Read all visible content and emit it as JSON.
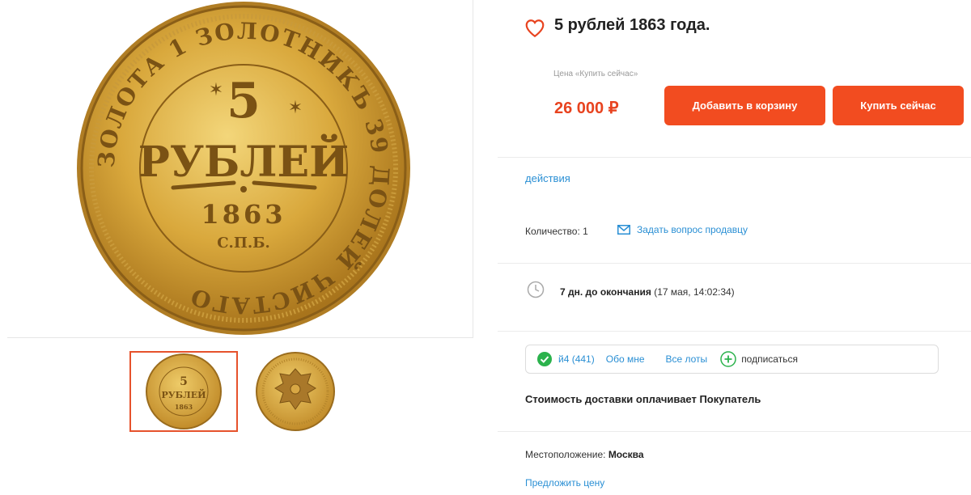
{
  "title": "5 рублей 1863 года.",
  "colors": {
    "accent": "#f24c20",
    "price": "#e8431f",
    "link": "#2a8fd4",
    "success": "#2bb24c"
  },
  "coin": {
    "denomination": "5",
    "word": "РУБЛЕЙ",
    "year": "1863",
    "mint": "С.П.Б.",
    "legend": "ЗОЛОТА 1 ЗОЛОТНИКЪ 39 ДОЛЕЙ ЧИСТАГО"
  },
  "price": {
    "label": "Цена «Купить сейчас»",
    "value": "26 000 ₽"
  },
  "buttons": {
    "add_to_cart": "Добавить в корзину",
    "buy_now": "Купить сейчас"
  },
  "actions_link": "действия",
  "quantity": {
    "text": "Количество: 1"
  },
  "ask_seller": "Задать вопрос продавцу",
  "ending": {
    "bold": "7 дн. до окончания",
    "date": "(17 мая, 14:02:34)"
  },
  "seller": {
    "name": "й4 (441)",
    "about": "Обо мне",
    "all_lots": "Все лоты",
    "subscribe": "подписаться"
  },
  "shipping": "Стоимость доставки оплачивает Покупатель",
  "location": {
    "label": "Местоположение:",
    "value": "Москва"
  },
  "offer_price": "Предложить цену",
  "icons": [
    "heart-icon",
    "mail-icon",
    "clock-icon",
    "check-circle-icon",
    "plus-circle-icon"
  ]
}
